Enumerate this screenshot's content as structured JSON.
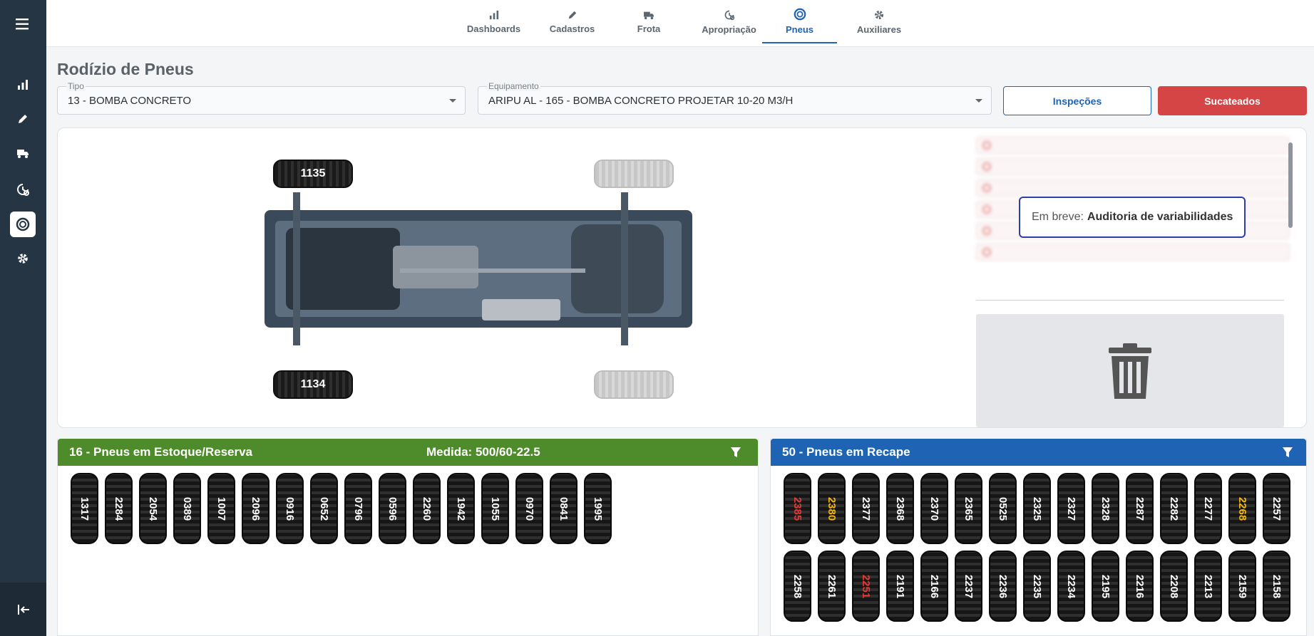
{
  "nav": {
    "items": [
      {
        "label": "Dashboards",
        "icon": "bar-chart-icon",
        "active": false
      },
      {
        "label": "Cadastros",
        "icon": "pencil-icon",
        "active": false
      },
      {
        "label": "Frota",
        "icon": "truck-icon",
        "active": false
      },
      {
        "label": "Apropriação",
        "icon": "history-gear-icon",
        "active": false
      },
      {
        "label": "Pneus",
        "icon": "tire-icon",
        "active": true
      },
      {
        "label": "Auxiliares",
        "icon": "gear-icon",
        "active": false
      }
    ]
  },
  "sidebar": {
    "icons": [
      "menu-icon",
      "bar-chart-icon",
      "pencil-icon",
      "truck-icon",
      "history-gear-icon",
      "tire-icon",
      "gear-icon",
      "logout-icon"
    ]
  },
  "page": {
    "title": "Rodízio de Pneus"
  },
  "filters": {
    "tipo": {
      "label": "Tipo",
      "value": "13 - BOMBA CONCRETO"
    },
    "equipamento": {
      "label": "Equipamento",
      "value": "ARIPU AL - 165 - BOMBA CONCRETO PROJETAR 10-20 M3/H"
    }
  },
  "actions": {
    "inspecoes": "Inspeções",
    "sucateados": "Sucateados"
  },
  "chassis": {
    "front_left": "1135",
    "front_right": "1134"
  },
  "tooltip": {
    "prefix": "Em breve:",
    "bold": "Auditoria de variabilidades"
  },
  "stock": {
    "title": "16 - Pneus em Estoque/Reserva",
    "medida": "Medida: 500/60-22.5",
    "color": "#4e8b2a",
    "tires": [
      {
        "id": "1317",
        "color": "#ffffff"
      },
      {
        "id": "2284",
        "color": "#ffffff"
      },
      {
        "id": "2054",
        "color": "#ffffff"
      },
      {
        "id": "0389",
        "color": "#ffffff"
      },
      {
        "id": "1007",
        "color": "#ffffff"
      },
      {
        "id": "2096",
        "color": "#ffffff"
      },
      {
        "id": "0916",
        "color": "#ffffff"
      },
      {
        "id": "0652",
        "color": "#ffffff"
      },
      {
        "id": "0796",
        "color": "#ffffff"
      },
      {
        "id": "0596",
        "color": "#ffffff"
      },
      {
        "id": "2260",
        "color": "#ffffff"
      },
      {
        "id": "1942",
        "color": "#ffffff"
      },
      {
        "id": "1055",
        "color": "#ffffff"
      },
      {
        "id": "0970",
        "color": "#ffffff"
      },
      {
        "id": "0841",
        "color": "#ffffff"
      },
      {
        "id": "1995",
        "color": "#ffffff"
      }
    ]
  },
  "recape": {
    "title": "50 - Pneus em Recape",
    "color": "#1e63b4",
    "tires": [
      {
        "id": "2385",
        "color": "#e53935"
      },
      {
        "id": "2380",
        "color": "#f5b50a"
      },
      {
        "id": "2377",
        "color": "#ffffff"
      },
      {
        "id": "2368",
        "color": "#ffffff"
      },
      {
        "id": "2370",
        "color": "#ffffff"
      },
      {
        "id": "2365",
        "color": "#ffffff"
      },
      {
        "id": "0525",
        "color": "#ffffff"
      },
      {
        "id": "2325",
        "color": "#ffffff"
      },
      {
        "id": "2327",
        "color": "#ffffff"
      },
      {
        "id": "2328",
        "color": "#ffffff"
      },
      {
        "id": "2287",
        "color": "#ffffff"
      },
      {
        "id": "2282",
        "color": "#ffffff"
      },
      {
        "id": "2277",
        "color": "#ffffff"
      },
      {
        "id": "2268",
        "color": "#f5b50a"
      },
      {
        "id": "2257",
        "color": "#ffffff"
      },
      {
        "id": "2258",
        "color": "#ffffff"
      },
      {
        "id": "2261",
        "color": "#ffffff"
      },
      {
        "id": "2251",
        "color": "#e53935"
      },
      {
        "id": "2191",
        "color": "#ffffff"
      },
      {
        "id": "2166",
        "color": "#ffffff"
      },
      {
        "id": "2237",
        "color": "#ffffff"
      },
      {
        "id": "2236",
        "color": "#ffffff"
      },
      {
        "id": "2235",
        "color": "#ffffff"
      },
      {
        "id": "2234",
        "color": "#ffffff"
      },
      {
        "id": "2195",
        "color": "#ffffff"
      },
      {
        "id": "2216",
        "color": "#ffffff"
      },
      {
        "id": "2208",
        "color": "#ffffff"
      },
      {
        "id": "2213",
        "color": "#ffffff"
      },
      {
        "id": "2159",
        "color": "#ffffff"
      },
      {
        "id": "2158",
        "color": "#ffffff"
      }
    ]
  }
}
